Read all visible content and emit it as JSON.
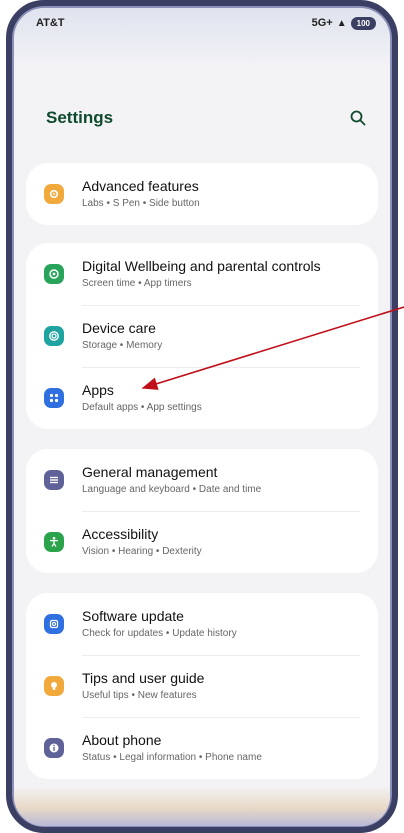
{
  "status_bar": {
    "carrier": "AT&T",
    "network": "5G+",
    "battery": "100"
  },
  "header": {
    "title": "Settings",
    "search_icon": "search-icon"
  },
  "groups": [
    {
      "items": [
        {
          "title": "Advanced features",
          "subtitle": "Labs • S Pen • Side button",
          "icon": "advanced-features-icon",
          "color": "#f2a93b"
        }
      ]
    },
    {
      "items": [
        {
          "title": "Digital Wellbeing and parental controls",
          "subtitle": "Screen time • App timers",
          "icon": "digital-wellbeing-icon",
          "color": "#27a35a"
        },
        {
          "title": "Device care",
          "subtitle": "Storage • Memory",
          "icon": "device-care-icon",
          "color": "#1fa3a0"
        },
        {
          "title": "Apps",
          "subtitle": "Default apps • App settings",
          "icon": "apps-icon",
          "color": "#2f6fe0"
        }
      ]
    },
    {
      "items": [
        {
          "title": "General management",
          "subtitle": "Language and keyboard • Date and time",
          "icon": "general-management-icon",
          "color": "#5e6299"
        },
        {
          "title": "Accessibility",
          "subtitle": "Vision • Hearing • Dexterity",
          "icon": "accessibility-icon",
          "color": "#2aa34a"
        }
      ]
    },
    {
      "items": [
        {
          "title": "Software update",
          "subtitle": "Check for updates • Update history",
          "icon": "software-update-icon",
          "color": "#2f6fe0"
        },
        {
          "title": "Tips and user guide",
          "subtitle": "Useful tips • New features",
          "icon": "tips-icon",
          "color": "#f2a93b"
        },
        {
          "title": "About phone",
          "subtitle": "Status • Legal information • Phone name",
          "icon": "about-phone-icon",
          "color": "#5e6299"
        }
      ]
    }
  ],
  "colors": {
    "annotation_arrow": "#c0101a",
    "title_green": "#0f4a2d"
  }
}
